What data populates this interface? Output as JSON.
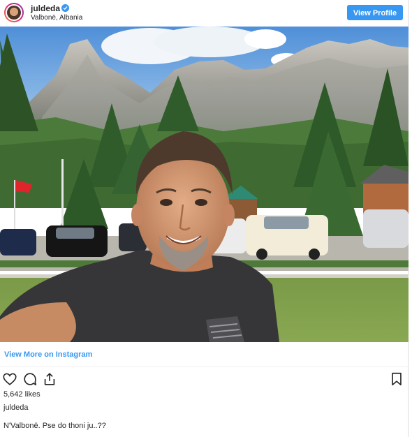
{
  "header": {
    "username": "juldeda",
    "verified": true,
    "location": "Valbonë, Albania",
    "view_profile_label": "View Profile"
  },
  "photo": {
    "subject": "selfie",
    "flag_color": "#e0242c"
  },
  "links": {
    "view_more": "View More on Instagram"
  },
  "actions": {
    "icons": [
      "heart-icon",
      "comment-icon",
      "share-icon",
      "bookmark-icon"
    ]
  },
  "stats": {
    "likes_text": "5,642 likes"
  },
  "post": {
    "owner": "juldeda",
    "caption": "N'Valbonë. Pse do thoni ju..??"
  },
  "colors": {
    "accent": "#3897f0",
    "text": "#262626"
  }
}
